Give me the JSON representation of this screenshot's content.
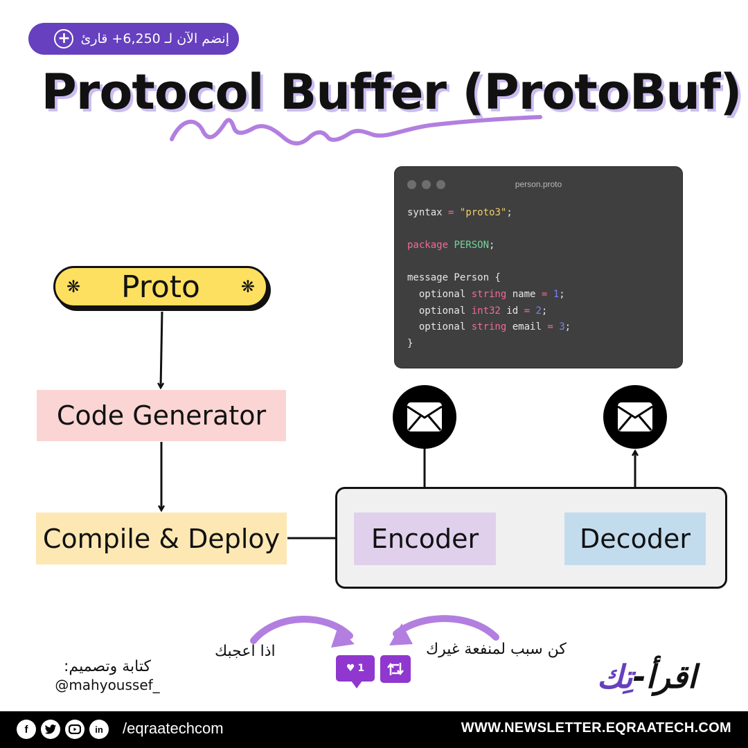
{
  "join_banner": {
    "text": "إنضم الآن لـ 6,250+ قارئ",
    "icon": "plus-circle-icon"
  },
  "title": "Protocol Buffer (ProtoBuf)",
  "code_window": {
    "filename": "person.proto",
    "lines": [
      [
        {
          "t": "syntax ",
          "c": ""
        },
        {
          "t": "=",
          "c": "op"
        },
        {
          "t": " ",
          "c": ""
        },
        {
          "t": "\"proto3\"",
          "c": "str"
        },
        {
          "t": ";",
          "c": ""
        }
      ],
      [],
      [
        {
          "t": "package",
          "c": "key"
        },
        {
          "t": " ",
          "c": ""
        },
        {
          "t": "PERSON",
          "c": "grn"
        },
        {
          "t": ";",
          "c": ""
        }
      ],
      [],
      [
        {
          "t": "message Person {",
          "c": ""
        }
      ],
      [
        {
          "t": "  optional ",
          "c": ""
        },
        {
          "t": "string",
          "c": "key"
        },
        {
          "t": " name ",
          "c": ""
        },
        {
          "t": "=",
          "c": "op"
        },
        {
          "t": " ",
          "c": ""
        },
        {
          "t": "1",
          "c": "num"
        },
        {
          "t": ";",
          "c": ""
        }
      ],
      [
        {
          "t": "  optional ",
          "c": ""
        },
        {
          "t": "int32",
          "c": "key"
        },
        {
          "t": " id ",
          "c": ""
        },
        {
          "t": "=",
          "c": "op"
        },
        {
          "t": " ",
          "c": ""
        },
        {
          "t": "2",
          "c": "num"
        },
        {
          "t": ";",
          "c": ""
        }
      ],
      [
        {
          "t": "  optional ",
          "c": ""
        },
        {
          "t": "string",
          "c": "key"
        },
        {
          "t": " email ",
          "c": ""
        },
        {
          "t": "=",
          "c": "op"
        },
        {
          "t": " ",
          "c": ""
        },
        {
          "t": "3",
          "c": "num"
        },
        {
          "t": ";",
          "c": ""
        }
      ],
      [
        {
          "t": "}",
          "c": ""
        }
      ]
    ]
  },
  "diagram": {
    "proto": "Proto",
    "code_generator": "Code Generator",
    "compile_deploy": "Compile & Deploy",
    "encoder": "Encoder",
    "decoder": "Decoder",
    "message_icon": "envelope-icon",
    "colors": {
      "proto": "#fde060",
      "code_generator": "#fad5d4",
      "compile_deploy": "#fde8b4",
      "encoder": "#e0d0ec",
      "decoder": "#c2dcee",
      "group": "#f0f0f0"
    }
  },
  "cta": {
    "like_text": "اذا اعجبك",
    "share_text": "كن سبب لمنفعة غيرك",
    "like_count": "1"
  },
  "credit": {
    "label": "كتابة وتصميم:",
    "handle": "@mahyoussef_"
  },
  "logo": {
    "part1": "اقرأ-",
    "part2": "تِك"
  },
  "footer": {
    "social_handle": "/eqraatechcom",
    "socials": [
      "facebook-icon",
      "twitter-icon",
      "youtube-icon",
      "linkedin-icon"
    ],
    "website": "WWW.NEWSLETTER.EQRAATECH.COM"
  },
  "colors": {
    "accent": "#6640be",
    "squiggle": "#b27fe0",
    "badge": "#8f37cf"
  }
}
